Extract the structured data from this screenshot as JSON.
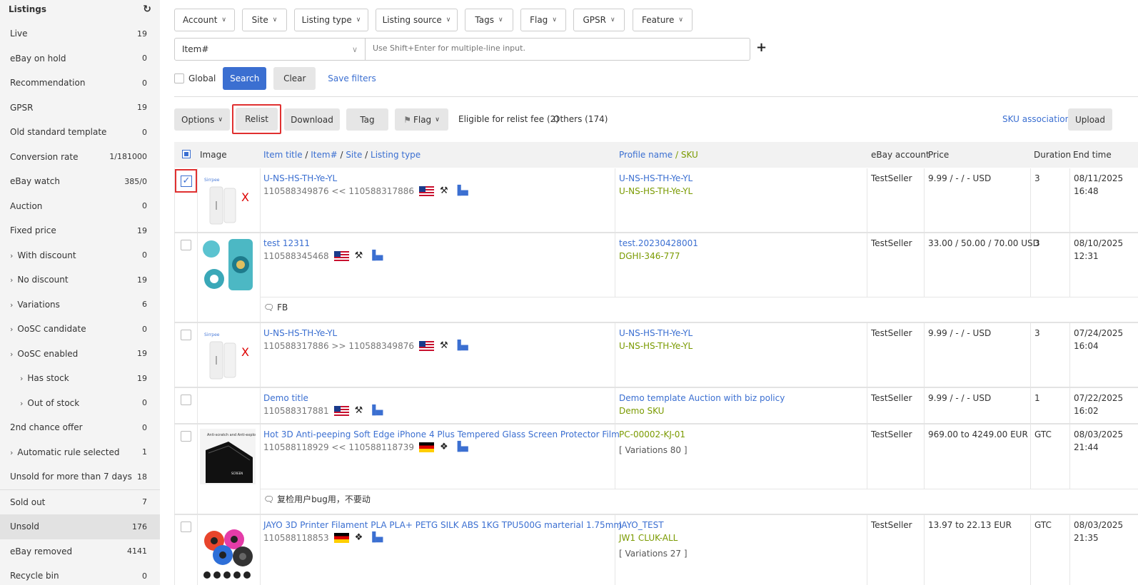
{
  "sidebar": {
    "title": "Listings",
    "items": [
      {
        "label": "Live",
        "count": "19"
      },
      {
        "label": "eBay on hold",
        "count": "0"
      },
      {
        "label": "Recommendation",
        "count": "0"
      },
      {
        "label": "GPSR",
        "count": "19"
      },
      {
        "label": "Old standard template",
        "count": "0"
      },
      {
        "label": "Conversion rate",
        "count": "1/181000"
      },
      {
        "label": "eBay watch",
        "count": "385/0"
      },
      {
        "label": "Auction",
        "count": "0"
      },
      {
        "label": "Fixed price",
        "count": "19"
      },
      {
        "label": "With discount",
        "count": "0"
      },
      {
        "label": "No discount",
        "count": "19"
      },
      {
        "label": "Variations",
        "count": "6"
      },
      {
        "label": "OoSC candidate",
        "count": "0"
      },
      {
        "label": "OoSC enabled",
        "count": "19"
      },
      {
        "label": "Has stock",
        "count": "19"
      },
      {
        "label": "Out of stock",
        "count": "0"
      },
      {
        "label": "2nd chance offer",
        "count": "0"
      },
      {
        "label": "Automatic rule selected",
        "count": "1"
      },
      {
        "label": "Unsold for more than 7 days",
        "count": "18"
      },
      {
        "label": "Sold out",
        "count": "7"
      },
      {
        "label": "Unsold",
        "count": "176"
      },
      {
        "label": "eBay removed",
        "count": "4141"
      },
      {
        "label": "Recycle bin",
        "count": "0"
      }
    ]
  },
  "filters": [
    "Account",
    "Site",
    "Listing type",
    "Listing source",
    "Tags",
    "Flag",
    "GPSR",
    "Feature"
  ],
  "search": {
    "select_value": "Item#",
    "placeholder": "Use Shift+Enter for multiple-line input.",
    "global_label": "Global",
    "search_label": "Search",
    "clear_label": "Clear",
    "save_filters_label": "Save filters"
  },
  "toolbar": {
    "options": "Options",
    "relist": "Relist",
    "download": "Download",
    "tag": "Tag",
    "flag": "Flag",
    "eligible": "Eligible for relist fee (2)",
    "others": "Others (174)",
    "sku_association": "SKU association",
    "upload": "Upload"
  },
  "table": {
    "headers": {
      "image": "Image",
      "item_title": "Item title",
      "item_no": "Item#",
      "site": "Site",
      "listing_type": "Listing type",
      "profile_name": "Profile name",
      "sku": "SKU",
      "ebay_account": "eBay account",
      "price": "Price",
      "duration": "Duration",
      "end_time": "End time"
    },
    "rows": [
      {
        "title": "U-NS-HS-TH-Ye-YL",
        "ids": "110588349876 << 110588317886",
        "profile": "U-NS-HS-TH-Ye-YL",
        "sku": "U-NS-HS-TH-Ye-YL",
        "account": "TestSeller",
        "price": "9.99 / - / - USD",
        "duration": "3",
        "end_date": "08/11/2025",
        "end_time": "16:48"
      },
      {
        "title": "test 12311",
        "ids": "110588345468",
        "profile": "test.20230428001",
        "sku": "DGHI-346-777",
        "account": "TestSeller",
        "price": "33.00 / 50.00 / 70.00 USD",
        "duration": "3",
        "end_date": "08/10/2025",
        "end_time": "12:31",
        "note": "FB"
      },
      {
        "title": "U-NS-HS-TH-Ye-YL",
        "ids": "110588317886 >> 110588349876",
        "profile": "U-NS-HS-TH-Ye-YL",
        "sku": "U-NS-HS-TH-Ye-YL",
        "account": "TestSeller",
        "price": "9.99 / - / - USD",
        "duration": "3",
        "end_date": "07/24/2025",
        "end_time": "16:04"
      },
      {
        "title": "Demo title",
        "ids": "110588317881",
        "profile": "Demo template Auction with biz policy",
        "sku": "Demo SKU",
        "account": "TestSeller",
        "price": "9.99 / - / - USD",
        "duration": "1",
        "end_date": "07/22/2025",
        "end_time": "16:02"
      },
      {
        "title": "Hot 3D Anti-peeping Soft Edge iPhone 4 Plus Tempered Glass Screen Protector Film",
        "ids": "110588118929 << 110588118739",
        "sku": "PC-00002-KJ-01",
        "variations": "[ Variations 80 ]",
        "account": "TestSeller",
        "price": "969.00 to 4249.00 EUR",
        "duration": "GTC",
        "end_date": "08/03/2025",
        "end_time": "21:44",
        "note": "复检用户bug用，不要动"
      },
      {
        "title": "JAYO 3D Printer Filament PLA PLA+ PETG SILK ABS 1KG TPU500G marterial 1.75mm",
        "ids": "110588118853",
        "profile": "JAYO_TEST",
        "sku": "JW1 CLUK-ALL",
        "variations": "[ Variations 27 ]",
        "account": "TestSeller",
        "price": "13.97 to 22.13 EUR",
        "duration": "GTC",
        "end_date": "08/03/2025",
        "end_time": "21:35"
      }
    ]
  },
  "colors": {
    "primary": "#3b6fd1",
    "sku_green": "#7a9a00",
    "note_orange": "#f28c00",
    "highlight_red": "#e03030"
  }
}
